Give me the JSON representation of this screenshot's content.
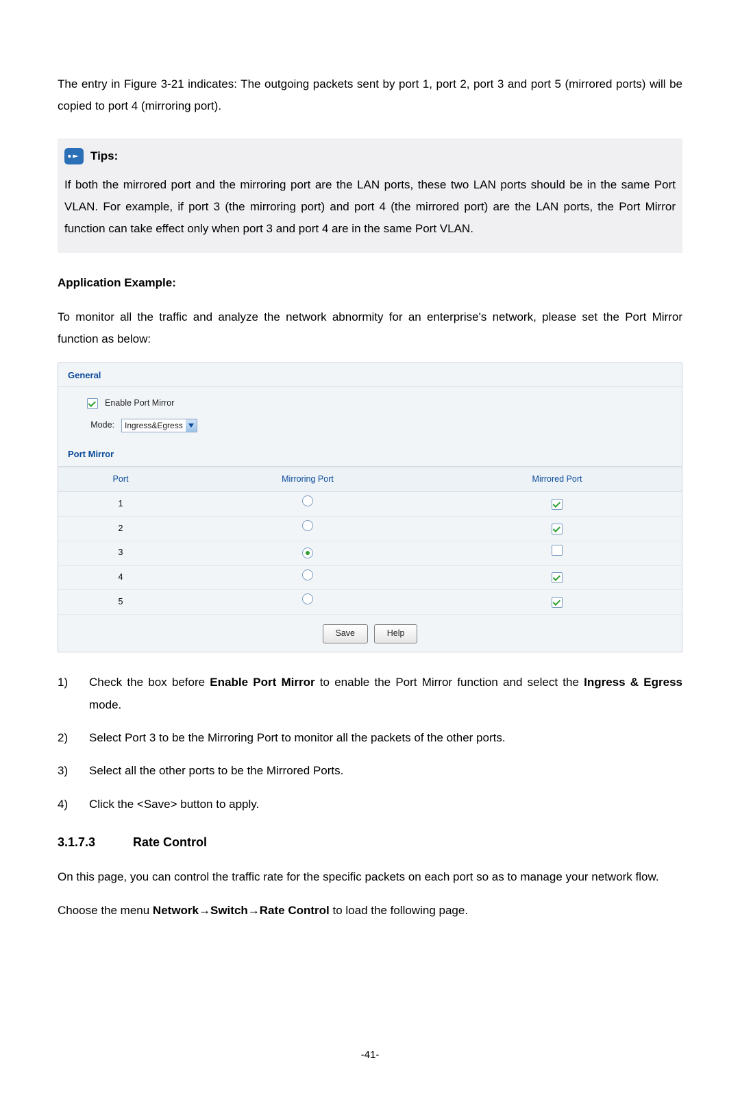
{
  "intro_text": "The entry in Figure 3-21 indicates: The outgoing packets sent by port 1, port 2, port 3 and port 5 (mirrored ports) will be copied to port 4 (mirroring port).",
  "tips": {
    "label": "Tips:",
    "content": "If both the mirrored port and the mirroring port are the LAN ports, these two LAN ports should be in the same Port VLAN. For example, if port 3 (the mirroring port) and port 4 (the mirrored port) are the LAN ports, the Port Mirror function can take effect only when port 3 and port 4 are in the same Port VLAN."
  },
  "app_example_heading": "Application Example:",
  "app_example_text": "To monitor all the traffic and analyze the network abnormity for an enterprise's network, please set the Port Mirror function as below:",
  "panel": {
    "general_title": "General",
    "enable_label": "Enable Port Mirror",
    "enable_checked": true,
    "mode_label": "Mode:",
    "mode_value": "Ingress&Egress",
    "section_title": "Port Mirror",
    "columns": {
      "port": "Port",
      "mirroring": "Mirroring Port",
      "mirrored": "Mirrored Port"
    },
    "rows": [
      {
        "port": "1",
        "mirroring_selected": false,
        "mirrored_checked": true
      },
      {
        "port": "2",
        "mirroring_selected": false,
        "mirrored_checked": true
      },
      {
        "port": "3",
        "mirroring_selected": true,
        "mirrored_checked": false
      },
      {
        "port": "4",
        "mirroring_selected": false,
        "mirrored_checked": true
      },
      {
        "port": "5",
        "mirroring_selected": false,
        "mirrored_checked": true
      }
    ],
    "save_btn": "Save",
    "help_btn": "Help"
  },
  "steps": {
    "s1a": "Check the box before ",
    "s1b": "Enable Port Mirror",
    "s1c": " to enable the Port Mirror function and select the ",
    "s1d": "Ingress & Egress",
    "s1e": " mode.",
    "s2": "Select Port 3 to be the Mirroring Port to monitor all the packets of the other ports.",
    "s3": "Select all the other ports to be the Mirrored Ports.",
    "s4": "Click the <Save> button to apply."
  },
  "rate_heading_num": "3.1.7.3",
  "rate_heading_title": "Rate Control",
  "rate_intro": "On this page, you can control the traffic rate for the specific packets on each port so as to manage your network flow.",
  "menu_text_a": "Choose the menu ",
  "menu_text_b": "Network→Switch→Rate Control",
  "menu_text_c": " to load the following page.",
  "page_number": "-41-"
}
